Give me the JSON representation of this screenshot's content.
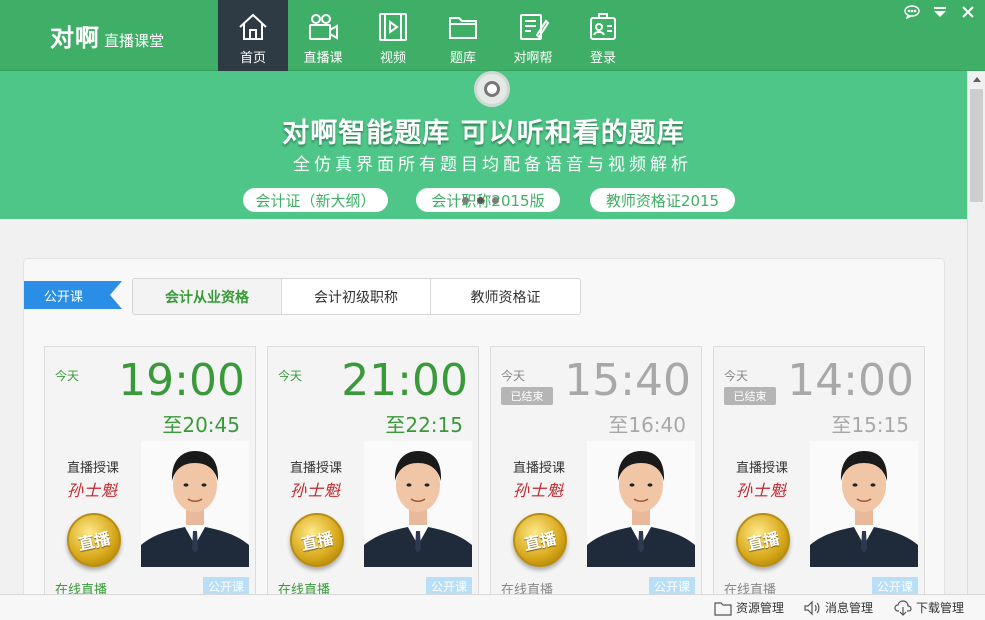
{
  "app": {
    "logo_main": "对啊",
    "logo_sub": "直播课堂"
  },
  "nav": [
    {
      "label": "首页",
      "icon": "home-icon",
      "active": true
    },
    {
      "label": "直播课",
      "icon": "video-camera-icon"
    },
    {
      "label": "视频",
      "icon": "film-icon"
    },
    {
      "label": "题库",
      "icon": "folder-icon"
    },
    {
      "label": "对啊帮",
      "icon": "edit-note-icon"
    },
    {
      "label": "登录",
      "icon": "id-card-icon"
    }
  ],
  "window_controls": [
    "chat-icon",
    "menu-down-icon",
    "close-icon"
  ],
  "banner": {
    "title": "对啊智能题库 可以听和看的题库",
    "subtitle": "全仿真界面所有题目均配备语音与视频解析",
    "pills": [
      "会计证（新大纲）",
      "会计职称2015版",
      "教师资格证2015"
    ]
  },
  "section": {
    "ribbon": "公开课",
    "tabs": [
      {
        "label": "会计从业资格",
        "active": true
      },
      {
        "label": "会计初级职称"
      },
      {
        "label": "教师资格证"
      }
    ]
  },
  "cards": [
    {
      "day": "今天",
      "start": "19:00",
      "end": "至20:45",
      "lecture": "直播授课",
      "teacher": "孙士魁",
      "medal": "直播",
      "mode": "在线直播",
      "type": "公开课",
      "ended": false
    },
    {
      "day": "今天",
      "start": "21:00",
      "end": "至22:15",
      "lecture": "直播授课",
      "teacher": "孙士魁",
      "medal": "直播",
      "mode": "在线直播",
      "type": "公开课",
      "ended": false
    },
    {
      "day": "今天",
      "ended_label": "已结束",
      "start": "15:40",
      "end": "至16:40",
      "lecture": "直播授课",
      "teacher": "孙士魁",
      "medal": "直播",
      "mode": "在线直播",
      "type": "公开课",
      "ended": true
    },
    {
      "day": "今天",
      "ended_label": "已结束",
      "start": "14:00",
      "end": "至15:15",
      "lecture": "直播授课",
      "teacher": "孙士魁",
      "medal": "直播",
      "mode": "在线直播",
      "type": "公开课",
      "ended": true
    }
  ],
  "statusbar": {
    "resources": "资源管理",
    "messages": "消息管理",
    "downloads": "下载管理"
  },
  "colors": {
    "brand": "#3fae66",
    "banner": "#4ec687",
    "accent_blue": "#2a8ee6",
    "nav_active": "#2e3b44"
  }
}
